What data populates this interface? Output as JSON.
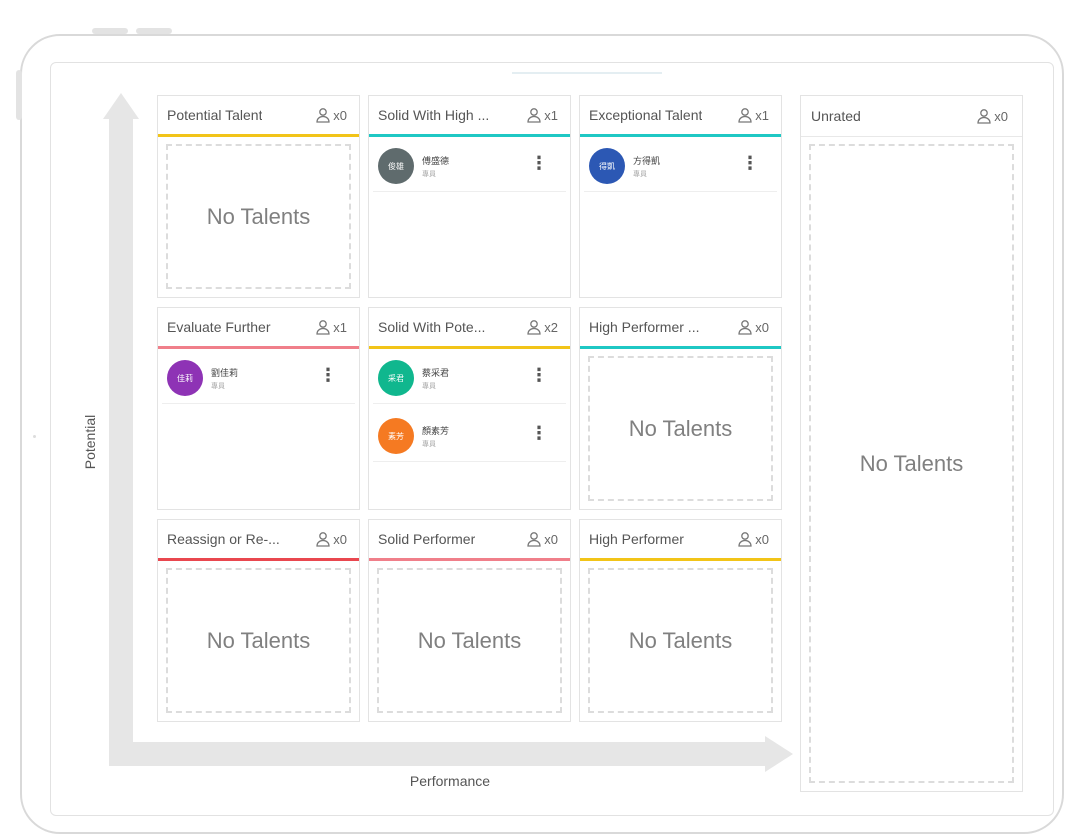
{
  "axes": {
    "x_label": "Performance",
    "y_label": "Potential"
  },
  "colors": {
    "yellow": "#f2c418",
    "teal": "#1fc8c4",
    "pink": "#f07f8a",
    "red": "#e9474f"
  },
  "cells": [
    {
      "title": "Potential Talent",
      "count": "x0",
      "empty_text": "No Talents",
      "talents": []
    },
    {
      "title": "Solid With High ...",
      "count": "x1",
      "empty_text": "",
      "talents": [
        {
          "avatar": "俊雄",
          "name": "傅盛德",
          "role": "專員",
          "color": "#5f6b6d"
        }
      ]
    },
    {
      "title": "Exceptional Talent",
      "count": "x1",
      "empty_text": "",
      "talents": [
        {
          "avatar": "得凱",
          "name": "方得凱",
          "role": "專員",
          "color": "#2c58b4"
        }
      ]
    },
    {
      "title": "Evaluate Further",
      "count": "x1",
      "empty_text": "",
      "talents": [
        {
          "avatar": "佳莉",
          "name": "劉佳莉",
          "role": "專員",
          "color": "#8e33b5"
        }
      ]
    },
    {
      "title": "Solid With Pote...",
      "count": "x2",
      "empty_text": "",
      "talents": [
        {
          "avatar": "采君",
          "name": "蔡采君",
          "role": "專員",
          "color": "#10b78e"
        },
        {
          "avatar": "素芳",
          "name": "顏素芳",
          "role": "專員",
          "color": "#f57a22"
        }
      ]
    },
    {
      "title": "High Performer ...",
      "count": "x0",
      "empty_text": "No Talents",
      "talents": []
    },
    {
      "title": "Reassign or Re-...",
      "count": "x0",
      "empty_text": "No Talents",
      "talents": []
    },
    {
      "title": "Solid Performer",
      "count": "x0",
      "empty_text": "No Talents",
      "talents": []
    },
    {
      "title": "High Performer",
      "count": "x0",
      "empty_text": "No Talents",
      "talents": []
    }
  ],
  "unrated": {
    "title": "Unrated",
    "count": "x0",
    "empty_text": "No Talents"
  },
  "icons": {
    "count_icon": "person-icon",
    "menu_icon": "kebab-menu-icon"
  }
}
